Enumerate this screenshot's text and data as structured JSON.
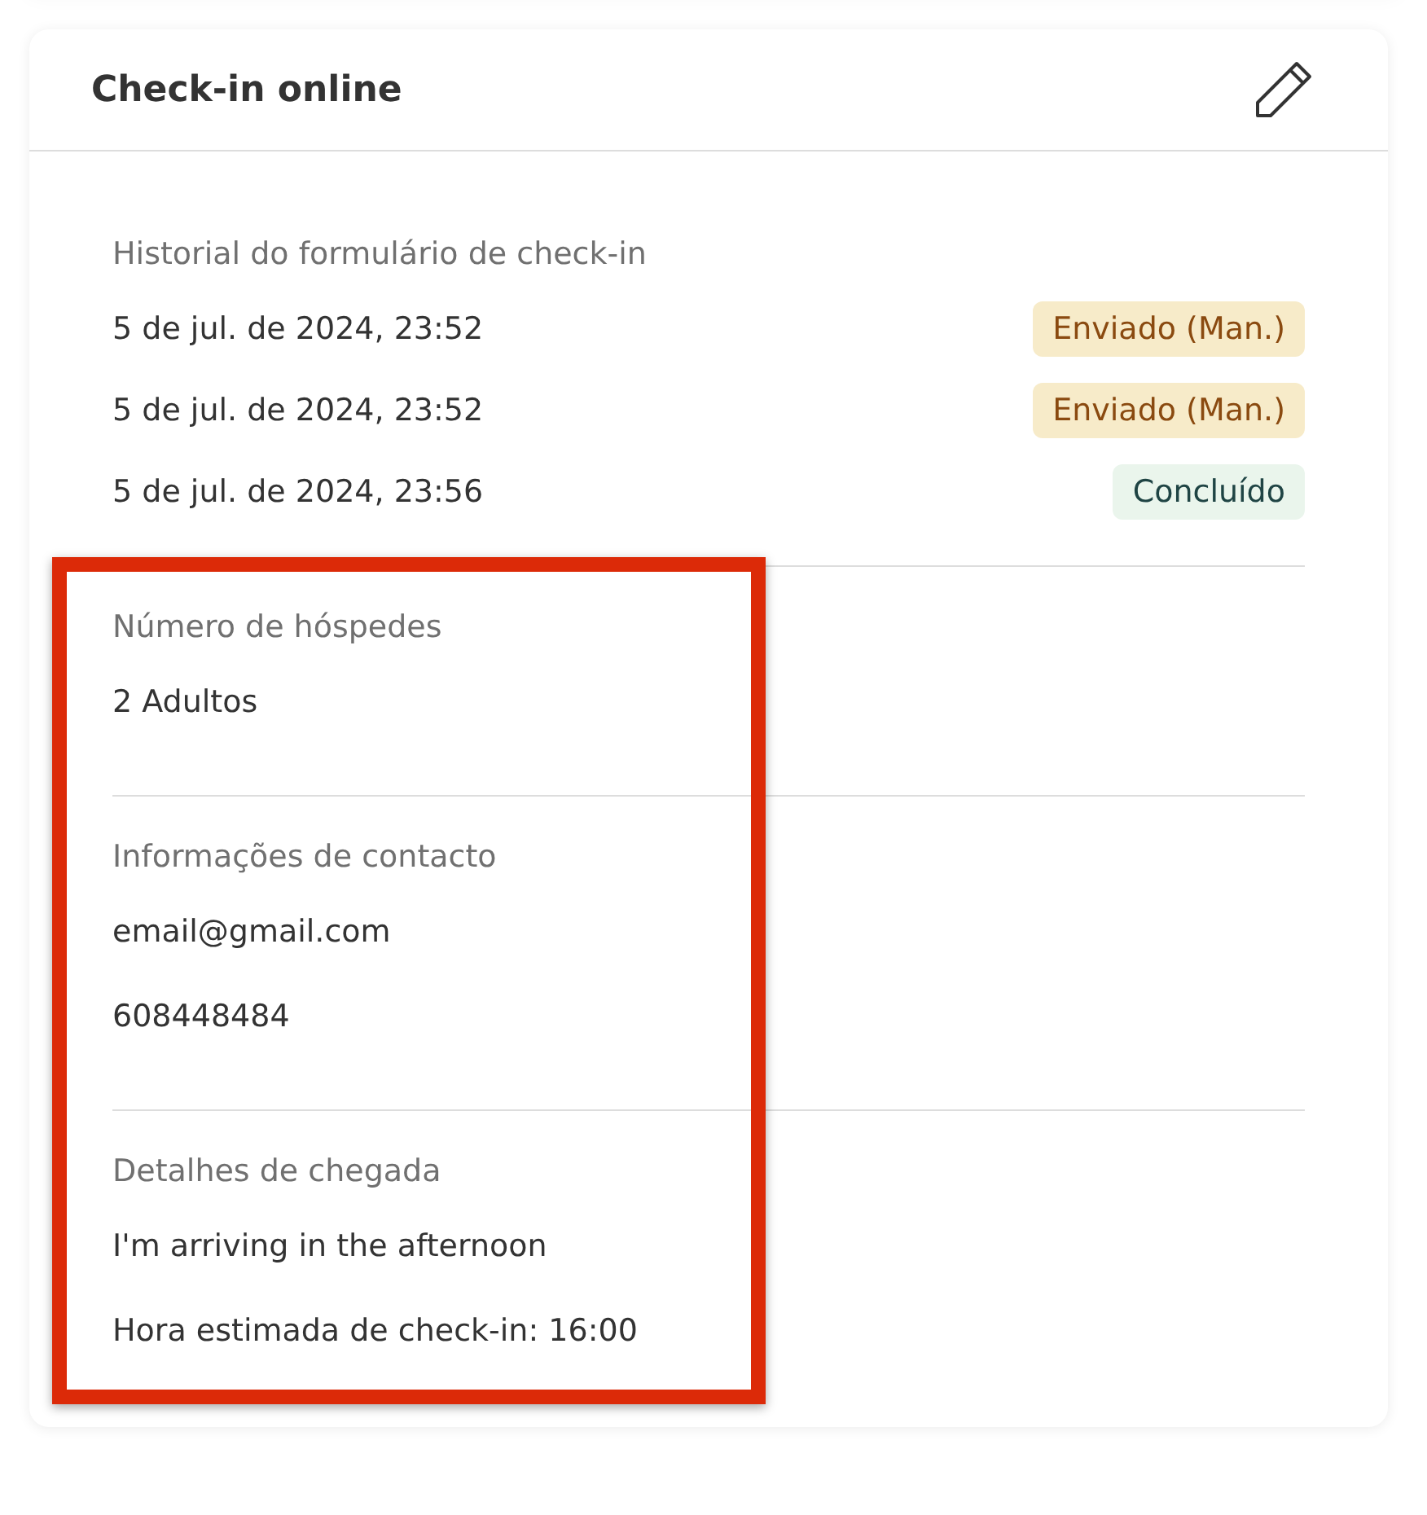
{
  "card": {
    "title": "Check-in online"
  },
  "history": {
    "label": "Historial do formulário de check-in",
    "entries": [
      {
        "date": "5 de jul. de 2024, 23:52",
        "status": "Enviado (Man.)",
        "kind": "sent"
      },
      {
        "date": "5 de jul. de 2024, 23:52",
        "status": "Enviado (Man.)",
        "kind": "sent"
      },
      {
        "date": "5 de jul. de 2024, 23:56",
        "status": "Concluído",
        "kind": "done"
      }
    ]
  },
  "sections": [
    {
      "label": "Número de hóspedes",
      "lines": [
        "2 Adultos"
      ]
    },
    {
      "label": "Informações de contacto",
      "lines": [
        "email@gmail.com",
        "608448484"
      ]
    },
    {
      "label": "Detalhes de chegada",
      "lines": [
        "I'm arriving in the afternoon",
        "Hora estimada de check-in: 16:00"
      ]
    }
  ],
  "annotation": {
    "kind": "highlight-box"
  }
}
